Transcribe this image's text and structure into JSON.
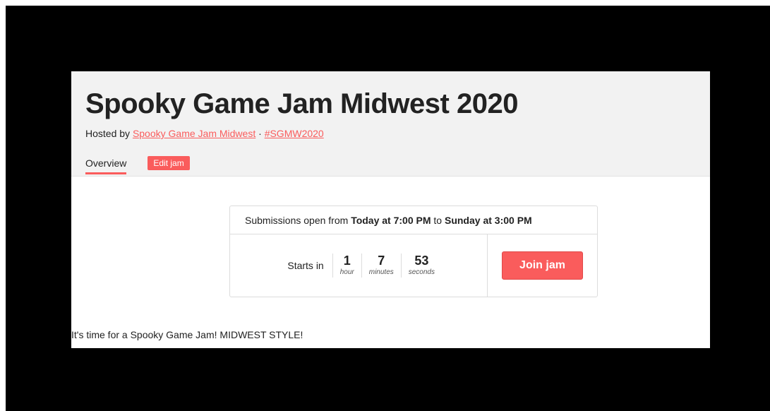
{
  "jam": {
    "title": "Spooky Game Jam Midwest 2020",
    "hosted_by_prefix": "Hosted by",
    "host_name": "Spooky Game Jam Midwest",
    "separator": "·",
    "hashtag": "#SGMW2020"
  },
  "tabs": {
    "overview_label": "Overview",
    "edit_label": "Edit jam"
  },
  "submission": {
    "prefix": "Submissions open from",
    "start": "Today at 7:00 PM",
    "middle": "to",
    "end": "Sunday at 3:00 PM"
  },
  "countdown": {
    "label": "Starts in",
    "hours": "1",
    "hours_label": "hour",
    "minutes": "7",
    "minutes_label": "minutes",
    "seconds": "53",
    "seconds_label": "seconds"
  },
  "join_label": "Join jam",
  "intro_text": "It's time for a Spooky Game Jam! MIDWEST STYLE!",
  "colors": {
    "accent": "#fa5c5c",
    "header_bg": "#f2f2f2",
    "backdrop": "#000000"
  }
}
